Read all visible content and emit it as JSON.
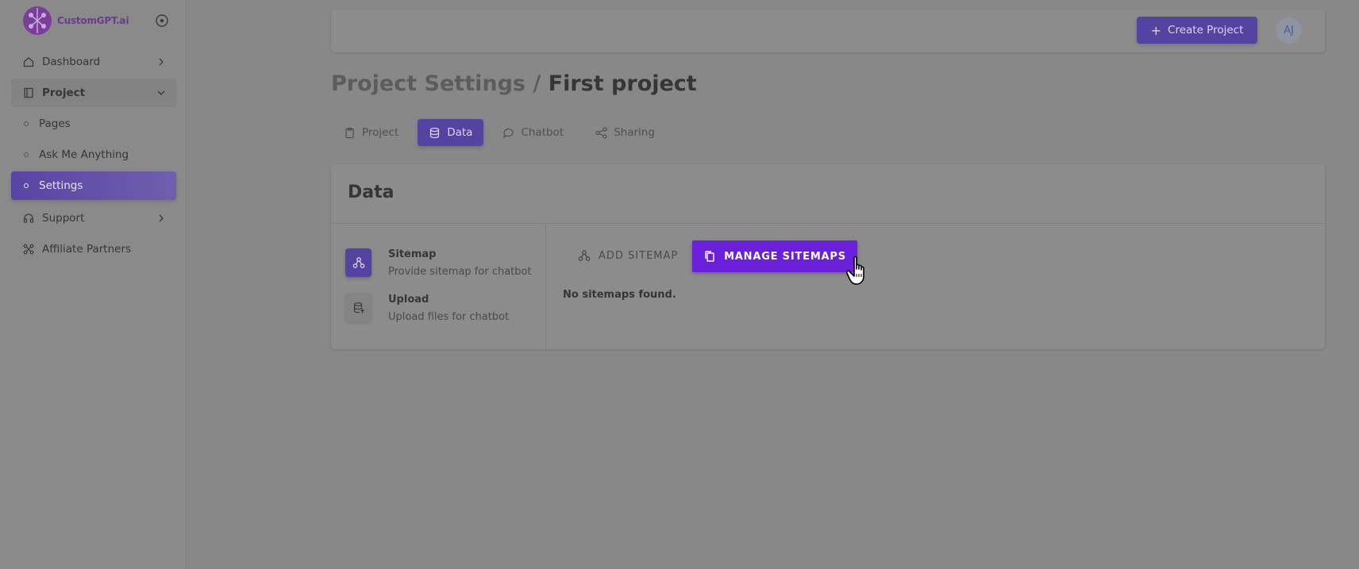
{
  "brand": {
    "name": "CustomGPT.ai",
    "accent": "#6b3a8f"
  },
  "sidebar": {
    "items": [
      {
        "label": "Dashboard",
        "icon": "home-icon"
      },
      {
        "label": "Project",
        "icon": "book-icon",
        "expanded": true
      },
      {
        "label": "Pages",
        "icon": "circle-icon"
      },
      {
        "label": "Ask Me Anything",
        "icon": "circle-icon"
      },
      {
        "label": "Settings",
        "icon": "circle-icon",
        "active": true
      },
      {
        "label": "Support",
        "icon": "headphones-icon"
      },
      {
        "label": "Affiliate Partners",
        "icon": "network-icon"
      }
    ]
  },
  "header": {
    "create_label": "Create Project",
    "avatar_initials": "AJ",
    "accent": "#5543a2"
  },
  "page": {
    "title_prefix": "Project Settings /",
    "title_main": "First project"
  },
  "tabs": [
    {
      "label": "Project",
      "icon": "clipboard-icon"
    },
    {
      "label": "Data",
      "icon": "database-icon",
      "active": true
    },
    {
      "label": "Chatbot",
      "icon": "chat-icon"
    },
    {
      "label": "Sharing",
      "icon": "share-icon"
    }
  ],
  "card": {
    "title": "Data",
    "options": [
      {
        "title": "Sitemap",
        "desc": "Provide sitemap for chatbot",
        "icon": "sitemap-icon",
        "active": true
      },
      {
        "title": "Upload",
        "desc": "Upload files for chatbot",
        "icon": "database-upload-icon"
      }
    ],
    "add_sitemap_label": "ADD SITEMAP",
    "manage_sitemaps_label": "MANAGE SITEMAPS",
    "manage_color": "#6a1fd8",
    "empty_message": "No sitemaps found."
  }
}
